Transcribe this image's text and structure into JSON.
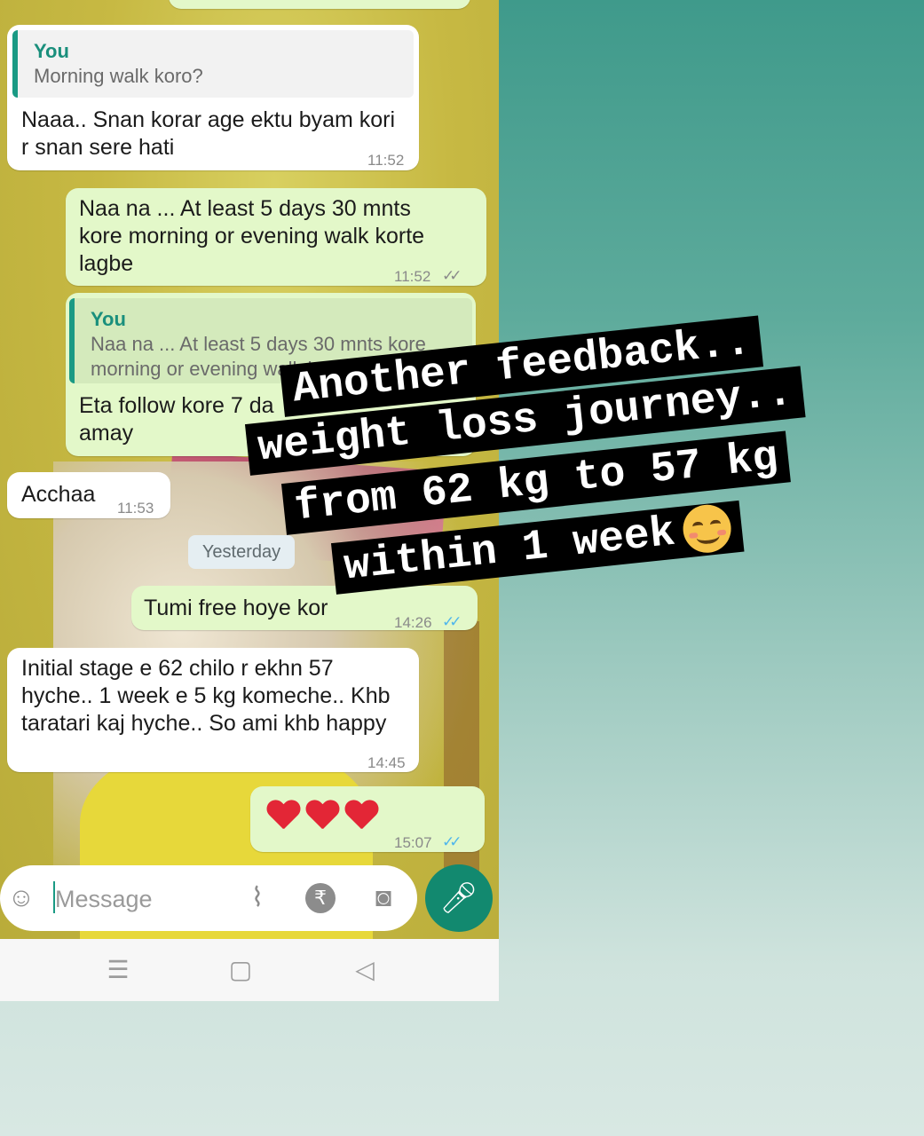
{
  "messages": {
    "m1": {
      "quote_author": "You",
      "quote_text": "Morning walk koro?",
      "text": "Naaa.. Snan korar age ektu byam kori\nr snan sere hati",
      "time": "11:52"
    },
    "m2": {
      "text": "Naa na ... At least 5 days 30 mnts\nkore morning or evening walk korte\nlagbe",
      "time": "11:52"
    },
    "m3": {
      "quote_author": "You",
      "quote_text": "Naa na ... At least 5 days 30 mnts kore\nmorning or evening walk korte lagbe",
      "text": "Eta follow kore 7 da\namay"
    },
    "m4": {
      "text": "Acchaa",
      "time": "11:53"
    },
    "date_divider": "Yesterday",
    "m5": {
      "text": "Tumi free hoye kor",
      "time": "14:26"
    },
    "m6": {
      "text": "Initial stage e 62 chilo r ekhn 57\nhyche.. 1 week e 5 kg komeche.. Khb\ntaratari kaj hyche.. So ami khb happy",
      "time": "14:45"
    },
    "m7": {
      "hearts": 3,
      "time": "15:07"
    }
  },
  "input": {
    "placeholder": "Message"
  },
  "caption": {
    "line1": "Another feedback..",
    "line2": "weight loss journey..",
    "line3": "from 62 kg to 57 kg",
    "line4": "within 1 week"
  },
  "icons": {
    "emoji": "emoji-icon",
    "attach": "paperclip-icon",
    "payment": "rupee-icon",
    "camera": "camera-icon",
    "mic": "mic-icon",
    "read_receipt": "double-check-icon"
  },
  "colors": {
    "accent": "#12896f",
    "outgoing_bubble": "#e3f8c9",
    "incoming_bubble": "#ffffff",
    "read_tick": "#4fb6ec"
  }
}
